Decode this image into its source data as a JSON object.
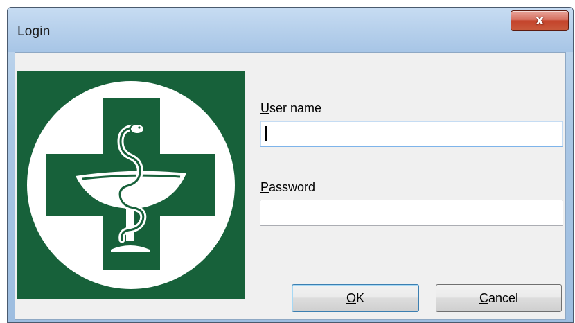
{
  "window": {
    "title": "Login",
    "close_glyph": "x",
    "close_icon": "close-icon"
  },
  "logo": {
    "icon": "pharmacy-cross-bowl-of-hygieia-icon",
    "background_color": "#17613a",
    "foreground_color": "#ffffff"
  },
  "form": {
    "username": {
      "label_accel": "U",
      "label_rest": "ser name",
      "value": ""
    },
    "password": {
      "label_accel": "P",
      "label_rest": "assword",
      "value": ""
    }
  },
  "buttons": {
    "ok": {
      "accel": "O",
      "rest": "K"
    },
    "cancel": {
      "accel": "C",
      "rest": "ancel"
    }
  },
  "colors": {
    "title_bar": "#b5cfeb",
    "close_button": "#c4432b",
    "client_background": "#f0f0f0",
    "focus_border": "#3c7fb1"
  }
}
